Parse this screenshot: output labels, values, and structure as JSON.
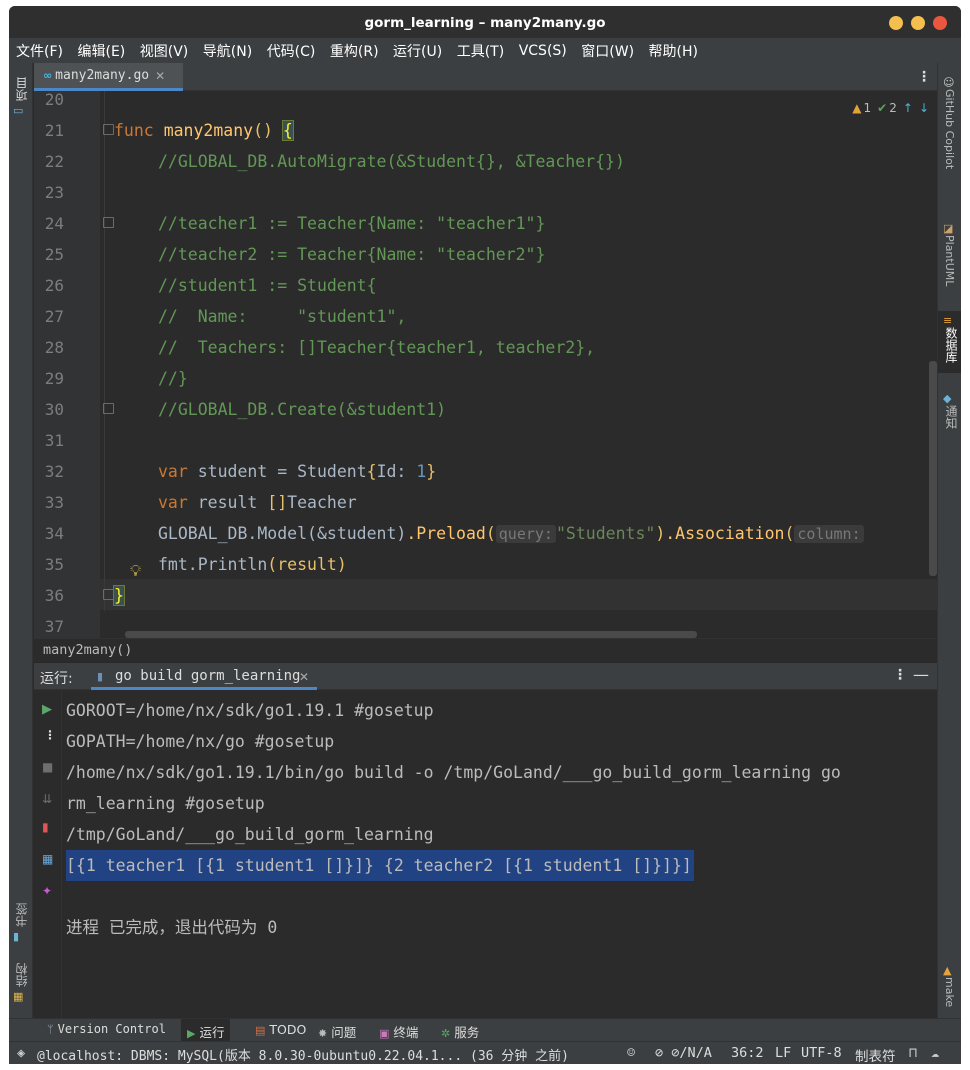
{
  "window": {
    "title": "gorm_learning – many2many.go"
  },
  "menu": [
    "文件(F)",
    "编辑(E)",
    "视图(V)",
    "导航(N)",
    "代码(C)",
    "重构(R)",
    "运行(U)",
    "工具(T)",
    "VCS(S)",
    "窗口(W)",
    "帮助(H)"
  ],
  "left_strip": {
    "project": "项目",
    "bookmarks": "书签",
    "structure": "结构"
  },
  "right_strip": {
    "copilot": "GitHub Copilot",
    "plantuml": "PlantUML",
    "database": "数据库",
    "notifications": "通知",
    "make": "make"
  },
  "editor": {
    "tab": {
      "filename": "many2many.go",
      "icon": "go-file-icon"
    },
    "indicators": {
      "warnings": "1",
      "weak_warnings": "2"
    },
    "partial_top_line": "20",
    "line_numbers": [
      "21",
      "22",
      "23",
      "24",
      "25",
      "26",
      "27",
      "28",
      "29",
      "30",
      "31",
      "32",
      "33",
      "34",
      "35",
      "36",
      "37"
    ],
    "code": {
      "l21": {
        "kw": "func",
        "name": "many2many",
        "parens": "()",
        "brace": "{"
      },
      "l22": "//GLOBAL_DB.AutoMigrate(&Student{}, &Teacher{})",
      "l24": "//teacher1 := Teacher{Name: \"teacher1\"}",
      "l25": "//teacher2 := Teacher{Name: \"teacher2\"}",
      "l26": "//student1 := Student{",
      "l27": "//  Name:     \"student1\",",
      "l28": "//  Teachers: []Teacher{teacher1, teacher2},",
      "l29": "//}",
      "l30": "//GLOBAL_DB.Create(&student1)",
      "l32": {
        "kw": "var",
        "rest": " student = Student",
        "open": "{",
        "field": "Id: ",
        "num": "1",
        "close": "}"
      },
      "l33": {
        "kw": "var",
        "rest": " result ",
        "slice": "[]",
        "type": "Teacher"
      },
      "l34": {
        "a": "GLOBAL_DB.Model",
        "b": "(&student)",
        "c": ".Preload",
        "d": "(",
        "hint1": "query:",
        "e": "\"Students\"",
        "f": ")",
        "g": ".Association",
        "h": "(",
        "hint2": "column:"
      },
      "l35": {
        "a": "fmt.Println",
        "b": "(result)"
      },
      "l36": "}"
    },
    "breadcrumb": "many2many()"
  },
  "run": {
    "label": "运行:",
    "tab": "go build gorm_learning",
    "output": [
      "GOROOT=/home/nx/sdk/go1.19.1 #gosetup",
      "GOPATH=/home/nx/go #gosetup",
      "/home/nx/sdk/go1.19.1/bin/go build -o /tmp/GoLand/___go_build_gorm_learning go",
      "rm_learning #gosetup",
      "/tmp/GoLand/___go_build_gorm_learning",
      "[{1 teacher1 [{1 student1 []}]} {2 teacher2 [{1 student1 []}]}]",
      "",
      "进程 已完成，退出代码为 0"
    ]
  },
  "toolstrip": {
    "vcs": "Version Control",
    "run": "运行",
    "todo": "TODO",
    "problems": "问题",
    "terminal": "终端",
    "services": "服务"
  },
  "status": {
    "db": "@localhost: DBMS: MySQL(版本 8.0.30-0ubuntu0.22.04.1... (36 分钟 之前)",
    "vcs": "⊘/N/A",
    "position": "36:2",
    "line_sep": "LF",
    "encoding": "UTF-8",
    "indent": "制表符"
  },
  "colors": {
    "accent": "#4a88c7",
    "selection": "#214283",
    "keyword": "#cc7832",
    "function": "#ffc66d",
    "comment": "#629755",
    "string": "#6a8759",
    "number": "#6897bb"
  }
}
